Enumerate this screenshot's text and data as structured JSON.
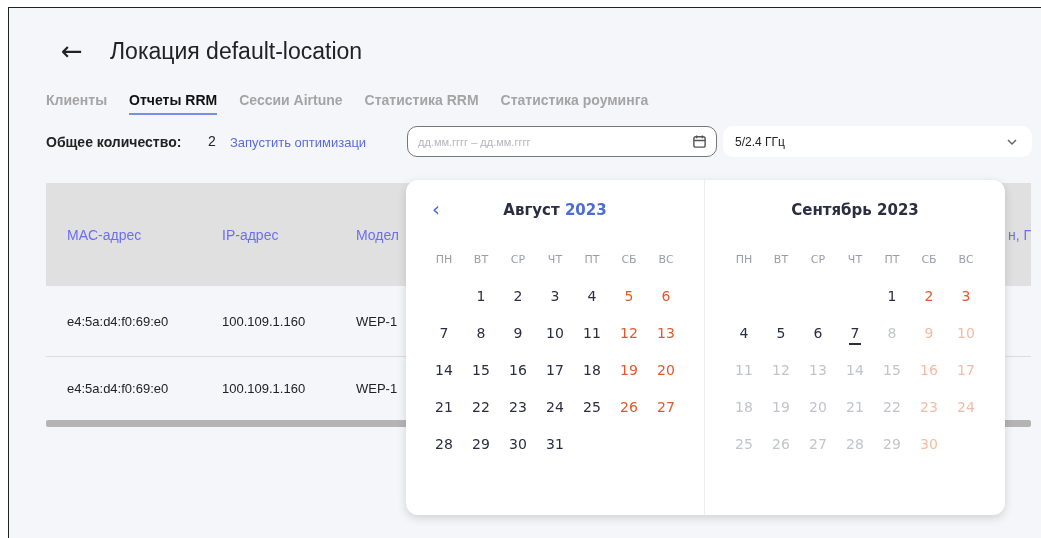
{
  "header": {
    "back": "←",
    "title": "Локация default-location"
  },
  "tabs": [
    {
      "label": "Клиенты",
      "selected": false
    },
    {
      "label": "Отчеты RRM",
      "selected": true
    },
    {
      "label": "Сессии Airtune",
      "selected": false
    },
    {
      "label": "Статистика RRM",
      "selected": false
    },
    {
      "label": "Статистика роуминга",
      "selected": false
    }
  ],
  "summary": {
    "label": "Общее количество:",
    "value": "2",
    "link": "Запустить оптимизаци"
  },
  "date_field": {
    "placeholder": "дд.мм.гггг – дд.мм.гггг"
  },
  "band_select": {
    "value": "5/2.4 ГГц"
  },
  "table": {
    "columns": [
      "MAC-адрес",
      "IP-адрес",
      "Модел",
      "н, Г"
    ],
    "rows": [
      [
        "e4:5a:d4:f0:69:e0",
        "100.109.1.160",
        "WEP-1"
      ],
      [
        "e4:5a:d4:f0:69:e0",
        "100.109.1.160",
        "WEP-1"
      ]
    ]
  },
  "calendar": {
    "months": [
      {
        "prev": "‹",
        "name": "Август",
        "year": "2023",
        "year_highlighted": true,
        "weekdays": [
          "ПН",
          "ВТ",
          "СР",
          "ЧТ",
          "ПТ",
          "СБ",
          "ВС"
        ],
        "days": [
          {
            "kind": "empty"
          },
          {
            "kind": "day",
            "text": "1",
            "weekend": false,
            "disabled": false,
            "today": false
          },
          {
            "kind": "day",
            "text": "2",
            "weekend": false,
            "disabled": false,
            "today": false
          },
          {
            "kind": "day",
            "text": "3",
            "weekend": false,
            "disabled": false,
            "today": false
          },
          {
            "kind": "day",
            "text": "4",
            "weekend": false,
            "disabled": false,
            "today": false
          },
          {
            "kind": "day",
            "text": "5",
            "weekend": true,
            "disabled": false,
            "today": false
          },
          {
            "kind": "day",
            "text": "6",
            "weekend": true,
            "disabled": false,
            "today": false
          },
          {
            "kind": "day",
            "text": "7",
            "weekend": false,
            "disabled": false,
            "today": false
          },
          {
            "kind": "day",
            "text": "8",
            "weekend": false,
            "disabled": false,
            "today": false
          },
          {
            "kind": "day",
            "text": "9",
            "weekend": false,
            "disabled": false,
            "today": false
          },
          {
            "kind": "day",
            "text": "10",
            "weekend": false,
            "disabled": false,
            "today": false
          },
          {
            "kind": "day",
            "text": "11",
            "weekend": false,
            "disabled": false,
            "today": false
          },
          {
            "kind": "day",
            "text": "12",
            "weekend": true,
            "disabled": false,
            "today": false
          },
          {
            "kind": "day",
            "text": "13",
            "weekend": true,
            "disabled": false,
            "today": false
          },
          {
            "kind": "day",
            "text": "14",
            "weekend": false,
            "disabled": false,
            "today": false
          },
          {
            "kind": "day",
            "text": "15",
            "weekend": false,
            "disabled": false,
            "today": false
          },
          {
            "kind": "day",
            "text": "16",
            "weekend": false,
            "disabled": false,
            "today": false
          },
          {
            "kind": "day",
            "text": "17",
            "weekend": false,
            "disabled": false,
            "today": false
          },
          {
            "kind": "day",
            "text": "18",
            "weekend": false,
            "disabled": false,
            "today": false
          },
          {
            "kind": "day",
            "text": "19",
            "weekend": true,
            "disabled": false,
            "today": false
          },
          {
            "kind": "day",
            "text": "20",
            "weekend": true,
            "disabled": false,
            "today": false
          },
          {
            "kind": "day",
            "text": "21",
            "weekend": false,
            "disabled": false,
            "today": false
          },
          {
            "kind": "day",
            "text": "22",
            "weekend": false,
            "disabled": false,
            "today": false
          },
          {
            "kind": "day",
            "text": "23",
            "weekend": false,
            "disabled": false,
            "today": false
          },
          {
            "kind": "day",
            "text": "24",
            "weekend": false,
            "disabled": false,
            "today": false
          },
          {
            "kind": "day",
            "text": "25",
            "weekend": false,
            "disabled": false,
            "today": false
          },
          {
            "kind": "day",
            "text": "26",
            "weekend": true,
            "disabled": false,
            "today": false
          },
          {
            "kind": "day",
            "text": "27",
            "weekend": true,
            "disabled": false,
            "today": false
          },
          {
            "kind": "day",
            "text": "28",
            "weekend": false,
            "disabled": false,
            "today": false
          },
          {
            "kind": "day",
            "text": "29",
            "weekend": false,
            "disabled": false,
            "today": false
          },
          {
            "kind": "day",
            "text": "30",
            "weekend": false,
            "disabled": false,
            "today": false
          },
          {
            "kind": "day",
            "text": "31",
            "weekend": false,
            "disabled": false,
            "today": false
          }
        ]
      },
      {
        "name": "Сентябрь",
        "year": "2023",
        "year_highlighted": false,
        "weekdays": [
          "ПН",
          "ВТ",
          "СР",
          "ЧТ",
          "ПТ",
          "СБ",
          "ВС"
        ],
        "days": [
          {
            "kind": "empty"
          },
          {
            "kind": "empty"
          },
          {
            "kind": "empty"
          },
          {
            "kind": "empty"
          },
          {
            "kind": "day",
            "text": "1",
            "weekend": false,
            "disabled": false,
            "today": false
          },
          {
            "kind": "day",
            "text": "2",
            "weekend": true,
            "disabled": false,
            "today": false
          },
          {
            "kind": "day",
            "text": "3",
            "weekend": true,
            "disabled": false,
            "today": false
          },
          {
            "kind": "day",
            "text": "4",
            "weekend": false,
            "disabled": false,
            "today": false
          },
          {
            "kind": "day",
            "text": "5",
            "weekend": false,
            "disabled": false,
            "today": false
          },
          {
            "kind": "day",
            "text": "6",
            "weekend": false,
            "disabled": false,
            "today": false
          },
          {
            "kind": "day",
            "text": "7",
            "weekend": false,
            "disabled": false,
            "today": true
          },
          {
            "kind": "day",
            "text": "8",
            "weekend": false,
            "disabled": true,
            "today": false
          },
          {
            "kind": "day",
            "text": "9",
            "weekend": true,
            "disabled": true,
            "today": false
          },
          {
            "kind": "day",
            "text": "10",
            "weekend": true,
            "disabled": true,
            "today": false
          },
          {
            "kind": "day",
            "text": "11",
            "weekend": false,
            "disabled": true,
            "today": false
          },
          {
            "kind": "day",
            "text": "12",
            "weekend": false,
            "disabled": true,
            "today": false
          },
          {
            "kind": "day",
            "text": "13",
            "weekend": false,
            "disabled": true,
            "today": false
          },
          {
            "kind": "day",
            "text": "14",
            "weekend": false,
            "disabled": true,
            "today": false
          },
          {
            "kind": "day",
            "text": "15",
            "weekend": false,
            "disabled": true,
            "today": false
          },
          {
            "kind": "day",
            "text": "16",
            "weekend": true,
            "disabled": true,
            "today": false
          },
          {
            "kind": "day",
            "text": "17",
            "weekend": true,
            "disabled": true,
            "today": false
          },
          {
            "kind": "day",
            "text": "18",
            "weekend": false,
            "disabled": true,
            "today": false
          },
          {
            "kind": "day",
            "text": "19",
            "weekend": false,
            "disabled": true,
            "today": false
          },
          {
            "kind": "day",
            "text": "20",
            "weekend": false,
            "disabled": true,
            "today": false
          },
          {
            "kind": "day",
            "text": "21",
            "weekend": false,
            "disabled": true,
            "today": false
          },
          {
            "kind": "day",
            "text": "22",
            "weekend": false,
            "disabled": true,
            "today": false
          },
          {
            "kind": "day",
            "text": "23",
            "weekend": true,
            "disabled": true,
            "today": false
          },
          {
            "kind": "day",
            "text": "24",
            "weekend": true,
            "disabled": true,
            "today": false
          },
          {
            "kind": "day",
            "text": "25",
            "weekend": false,
            "disabled": true,
            "today": false
          },
          {
            "kind": "day",
            "text": "26",
            "weekend": false,
            "disabled": true,
            "today": false
          },
          {
            "kind": "day",
            "text": "27",
            "weekend": false,
            "disabled": true,
            "today": false
          },
          {
            "kind": "day",
            "text": "28",
            "weekend": false,
            "disabled": true,
            "today": false
          },
          {
            "kind": "day",
            "text": "29",
            "weekend": false,
            "disabled": true,
            "today": false
          },
          {
            "kind": "day",
            "text": "30",
            "weekend": true,
            "disabled": true,
            "today": false
          }
        ]
      }
    ]
  }
}
